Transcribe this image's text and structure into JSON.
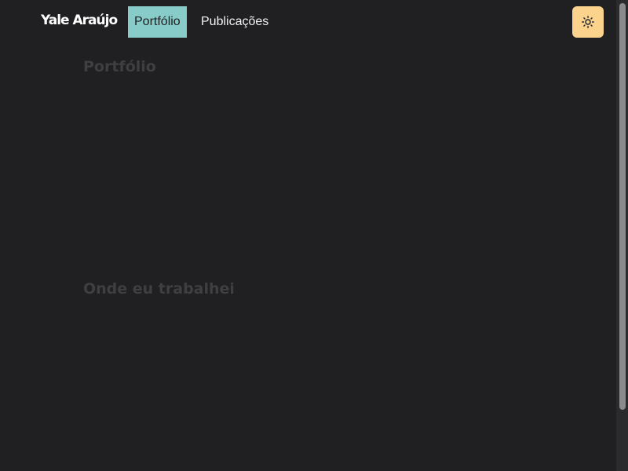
{
  "header": {
    "logo_text": "Yale Araújo",
    "nav": [
      {
        "label": "Portfólio",
        "active": true
      },
      {
        "label": "Publicações",
        "active": false
      }
    ],
    "theme_toggle_icon": "sun-icon"
  },
  "main": {
    "sections": [
      {
        "heading": "Portfólio"
      },
      {
        "heading": "Onde eu trabalhei"
      }
    ]
  },
  "colors": {
    "background": "#202023",
    "active_nav": "#88ccca",
    "theme_toggle": "#fbd38d",
    "heading_text": "#3f3f42"
  }
}
